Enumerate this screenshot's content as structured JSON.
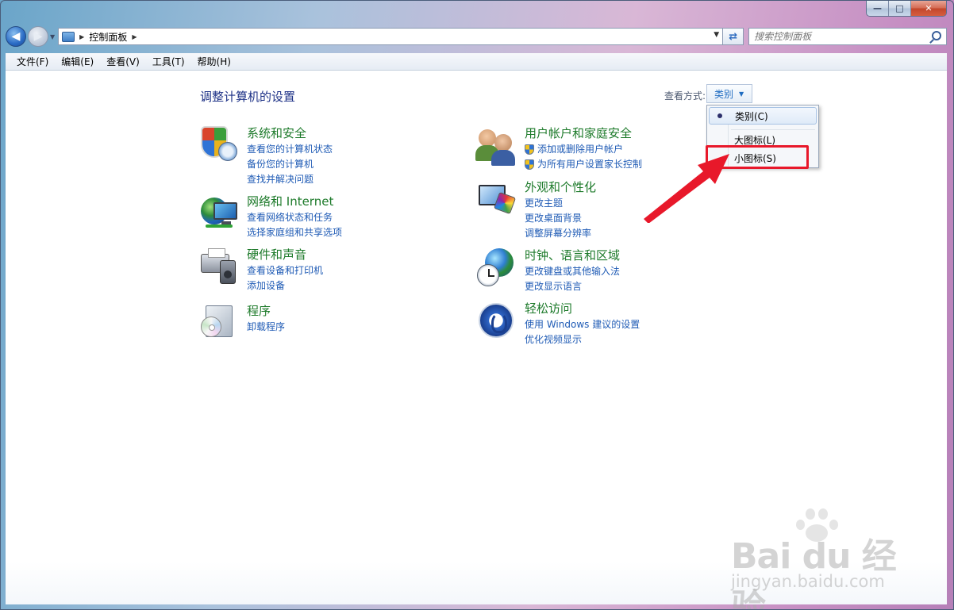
{
  "window": {
    "minimize_label": "—",
    "maximize_label": "□",
    "close_label": "✕"
  },
  "address": {
    "breadcrumb": "控制面板",
    "search_placeholder": "搜索控制面板"
  },
  "menu": [
    "文件(F)",
    "编辑(E)",
    "查看(V)",
    "工具(T)",
    "帮助(H)"
  ],
  "content": {
    "title": "调整计算机的设置",
    "view_by_label": "查看方式:",
    "view_by_value": "类别"
  },
  "categories": [
    {
      "title": "系统和安全",
      "icon": "system-security-icon",
      "links": [
        "查看您的计算机状态",
        "备份您的计算机",
        "查找并解决问题"
      ]
    },
    {
      "title": "网络和 Internet",
      "icon": "network-internet-icon",
      "links": [
        "查看网络状态和任务",
        "选择家庭组和共享选项"
      ]
    },
    {
      "title": "硬件和声音",
      "icon": "hardware-sound-icon",
      "links": [
        "查看设备和打印机",
        "添加设备"
      ]
    },
    {
      "title": "程序",
      "icon": "programs-icon",
      "links": [
        "卸载程序"
      ]
    },
    {
      "title": "用户帐户和家庭安全",
      "icon": "user-accounts-icon",
      "links": [
        "添加或删除用户帐户",
        "为所有用户设置家长控制"
      ]
    },
    {
      "title": "外观和个性化",
      "icon": "appearance-icon",
      "links": [
        "更改主题",
        "更改桌面背景",
        "调整屏幕分辨率"
      ]
    },
    {
      "title": "时钟、语言和区域",
      "icon": "clock-language-icon",
      "links": [
        "更改键盘或其他输入法",
        "更改显示语言"
      ]
    },
    {
      "title": "轻松访问",
      "icon": "ease-of-access-icon",
      "links": [
        "使用 Windows 建议的设置",
        "优化视频显示"
      ]
    }
  ],
  "dropdown": {
    "items": [
      "类别(C)",
      "大图标(L)",
      "小图标(S)"
    ],
    "selected_index": 0
  },
  "annotation": {
    "color": "#e8182a"
  },
  "watermark": {
    "brand": "Bai du 经验",
    "url": "jingyan.baidu.com"
  }
}
